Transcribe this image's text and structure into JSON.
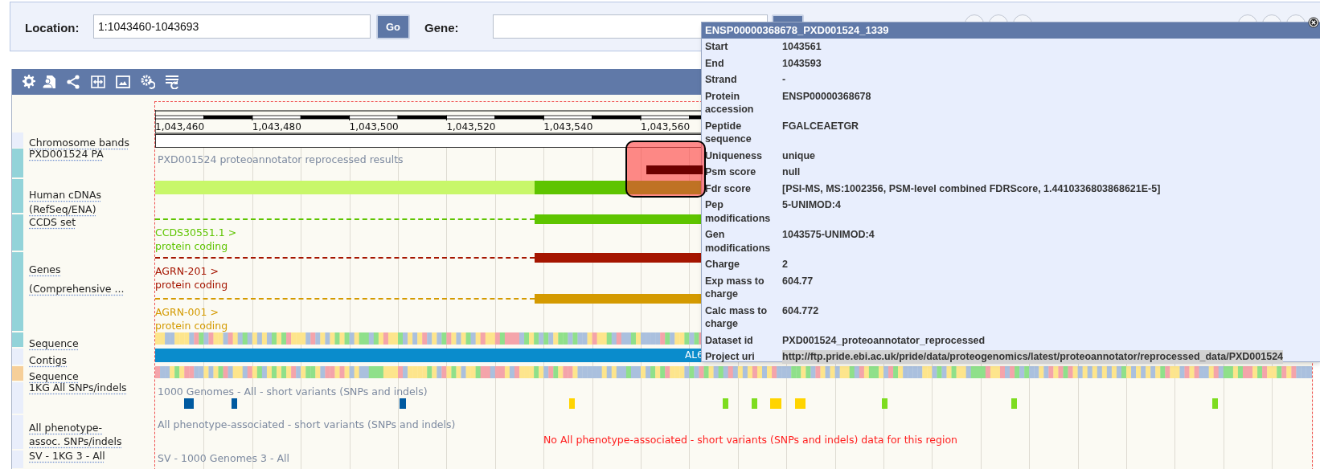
{
  "search_bar": {
    "location_label": "Location:",
    "location_value": "1:1043460-1043693",
    "go_button": "Go",
    "gene_label": "Gene:"
  },
  "track_labels": [
    {
      "lines": [
        "Chromosome bands"
      ],
      "color": "#e9eefb"
    },
    {
      "lines": [
        "PXD001524 PA"
      ],
      "color": "#93d3d9"
    },
    {
      "lines": [
        "Human cDNAs",
        "(RefSeq/ENA)"
      ],
      "color": "#93d3d9"
    },
    {
      "lines": [
        "CCDS set"
      ],
      "color": "#93d3d9"
    },
    {
      "lines": [
        "Genes",
        "(Comprehensive ..."
      ],
      "color": "#93d3d9"
    },
    {
      "lines": [
        "Sequence"
      ],
      "color": "#93d3d9"
    },
    {
      "lines": [
        "Contigs"
      ],
      "color": "#e9eefb"
    },
    {
      "lines": [
        "Sequence"
      ],
      "color": "#f6cf99"
    },
    {
      "lines": [
        "1KG All SNPs/indels"
      ],
      "color": "#e9eefb"
    },
    {
      "lines": [
        "All phenotype-",
        "assoc. SNPs/indels"
      ],
      "color": "#e9eefb"
    },
    {
      "lines": [
        "SV - 1KG 3 - All"
      ],
      "color": "#e9eefb"
    }
  ],
  "ruler": {
    "ticks": [
      "1,043,460",
      "1,043,480",
      "1,043,500",
      "1,043,520",
      "1,043,540",
      "1,043,560"
    ]
  },
  "tracks": {
    "pxd_caption": "PXD001524 proteoannotator reprocessed results",
    "transcripts": [
      {
        "label": "CCDS30551.1 >",
        "biotype": "protein coding",
        "color": "#5ec400"
      },
      {
        "label": "AGRN-201 >",
        "biotype": "protein coding",
        "color": "#a51500"
      },
      {
        "label": "AGRN-001 >",
        "biotype": "protein coding",
        "color": "#d49a00"
      }
    ],
    "contig_label": "AL6",
    "variants_caption": "1000 Genomes - All - short variants (SNPs and indels)",
    "phenotype_caption": "All phenotype-associated - short variants (SNPs and indels)",
    "phenotype_message": "No All phenotype-associated - short variants (SNPs and indels) data for this region",
    "sv_caption": "SV - 1000 Genomes 3 - All"
  },
  "popup": {
    "title": "ENSP00000368678_PXD001524_1339",
    "rows": [
      {
        "key": "Start",
        "value": "1043561",
        "selected": false
      },
      {
        "key": "End",
        "value": "1043593",
        "selected": false
      },
      {
        "key": "Strand",
        "value": "-",
        "selected": false
      },
      {
        "key": "Protein\naccession",
        "value": "ENSP00000368678",
        "selected": false
      },
      {
        "key": "Peptide\nsequence",
        "value": "FGALCEAETGR",
        "selected": false
      },
      {
        "key": "Uniqueness",
        "value": "unique",
        "selected": false
      },
      {
        "key": "Psm score",
        "value": "null",
        "selected": false
      },
      {
        "key": "Fdr score",
        "value": "[PSI-MS, MS:1002356, PSM-level combined FDRScore, 1.4410336803868621E-5]",
        "selected": false
      },
      {
        "key": "Pep\nmodifications",
        "value": "5-UNIMOD:4",
        "selected": false
      },
      {
        "key": "Gen\nmodifications",
        "value": "1043575-UNIMOD:4",
        "selected": false
      },
      {
        "key": "Charge",
        "value": "2",
        "selected": false
      },
      {
        "key": "Exp mass to\ncharge",
        "value": "604.77",
        "selected": false
      },
      {
        "key": "Calc mass to\ncharge",
        "value": "604.772",
        "selected": false
      },
      {
        "key": "Dataset id",
        "value": "PXD001524_proteoannotator_reprocessed",
        "selected": false
      },
      {
        "key": "Project uri",
        "value": "http://ftp.pride.ebi.ac.uk/pride/data/proteogenomics/latest/proteoannotator/reprocessed_data/PXD001524",
        "selected": true
      }
    ]
  }
}
